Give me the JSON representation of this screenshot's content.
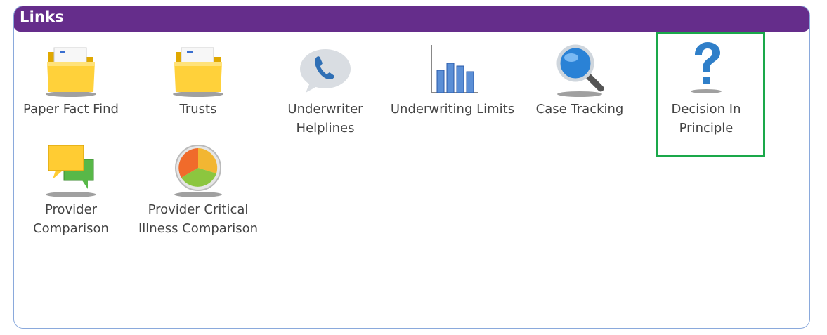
{
  "panel": {
    "title": "Links",
    "header_color": "#652d8b",
    "highlight_color": "#1aa84a"
  },
  "links": [
    {
      "label": "Paper Fact Find",
      "icon": "folder-icon"
    },
    {
      "label": "Trusts",
      "icon": "folder-icon"
    },
    {
      "label": "Underwriter Helplines",
      "icon": "phone-bubble-icon"
    },
    {
      "label": "Underwriting Limits",
      "icon": "bar-chart-icon"
    },
    {
      "label": "Case Tracking",
      "icon": "magnifier-icon"
    },
    {
      "label": "Decision In Principle",
      "icon": "question-mark-icon",
      "selected": true
    },
    {
      "label": "Provider Comparison",
      "icon": "speech-bubbles-icon"
    },
    {
      "label": "Provider Critical Illness Comparison",
      "icon": "pie-chart-icon"
    }
  ]
}
